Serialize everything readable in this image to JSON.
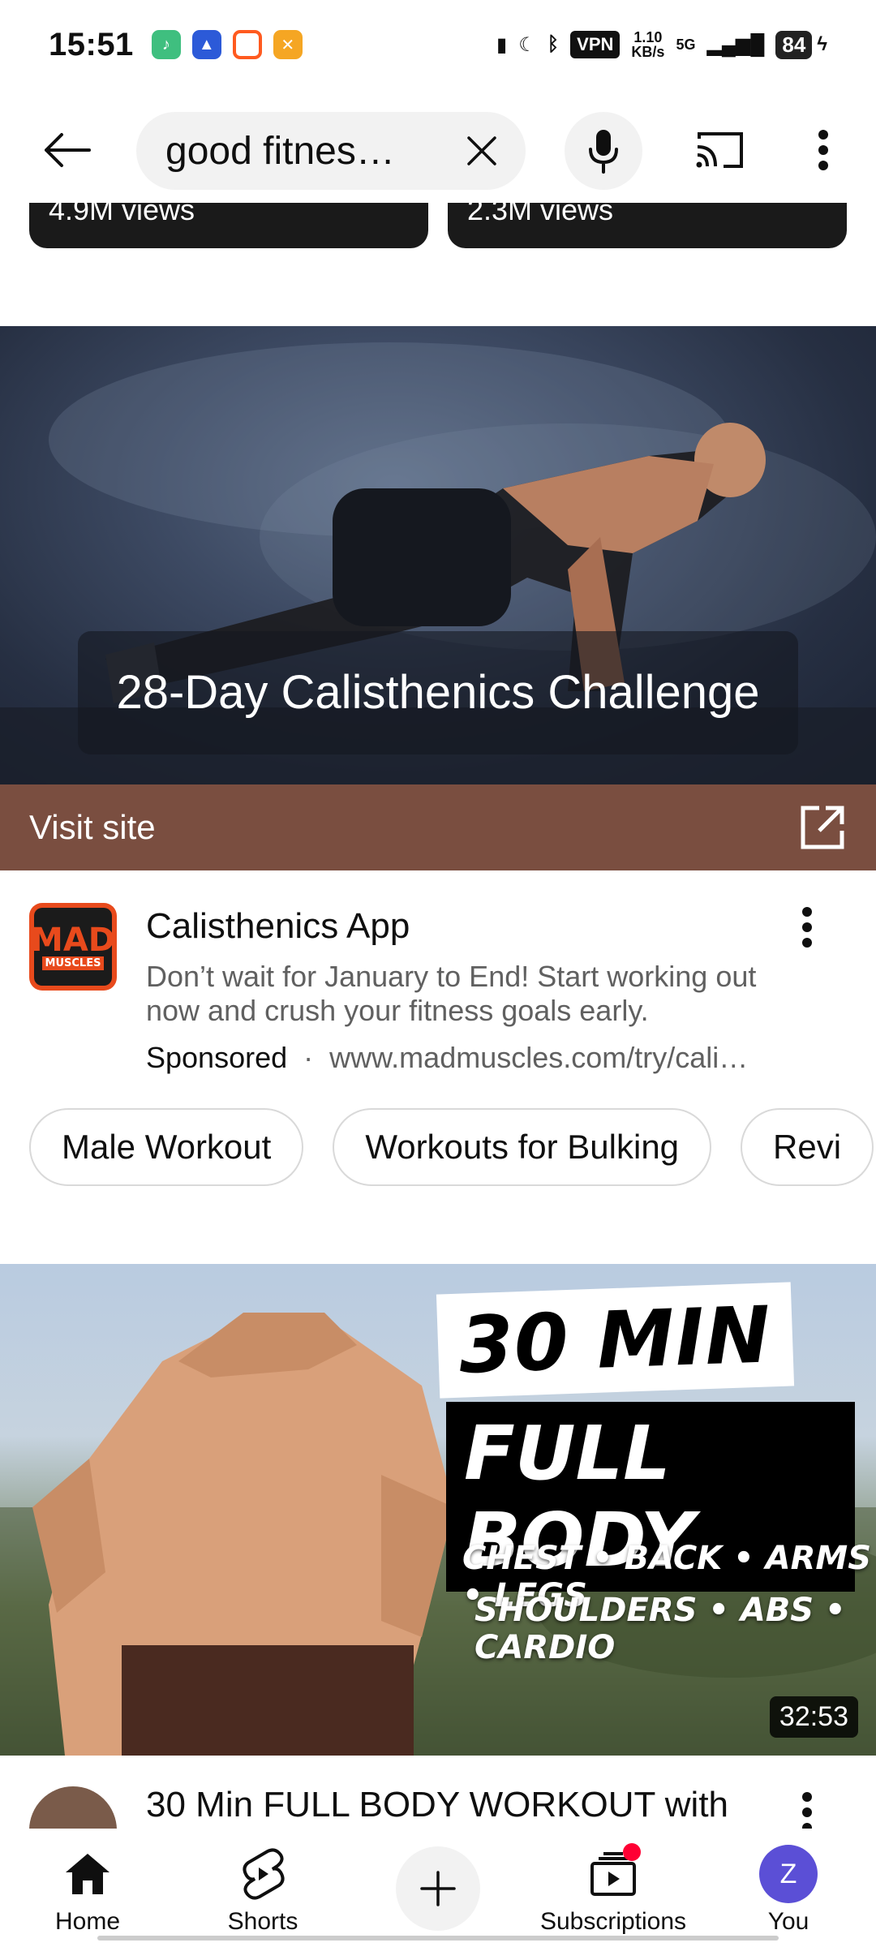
{
  "status_bar": {
    "time": "15:51",
    "vpn": "VPN",
    "speed_value": "1.10",
    "speed_unit": "KB/s",
    "network": "5G",
    "battery": "84"
  },
  "search": {
    "query": "good fitnes…"
  },
  "previous_results": [
    {
      "views": "4.9M views"
    },
    {
      "views": "2.3M views"
    }
  ],
  "ad": {
    "banner_text": "28-Day Calisthenics Challenge",
    "visit_label": "Visit site",
    "logo_text_top": "MAD",
    "logo_text_bottom": "MUSCLES",
    "title": "Calisthenics App",
    "description": "Don’t wait for January to End! Start working out now and crush your fitness goals early.",
    "sponsored_label": "Sponsored",
    "separator": "·",
    "url": "www.madmuscles.com/try/cali…"
  },
  "chips": [
    {
      "label": "Male Workout"
    },
    {
      "label": "Workouts for Bulking"
    },
    {
      "label": "Revi"
    }
  ],
  "video": {
    "thumb_line1": "30 MIN",
    "thumb_line2": "FULL BODY",
    "thumb_line3": "CHEST • BACK • ARMS • LEGS",
    "thumb_line4": "SHOULDERS • ABS • CARDIO",
    "duration": "32:53",
    "title": "30 Min FULL BODY WORKOUT with"
  },
  "bottom_nav": {
    "home": "Home",
    "shorts": "Shorts",
    "subscriptions": "Subscriptions",
    "you": "You",
    "you_initial": "Z"
  },
  "colors": {
    "visit_bar": "#7a4e40",
    "avatar": "#5b4fd6",
    "notification": "#ff0033"
  }
}
